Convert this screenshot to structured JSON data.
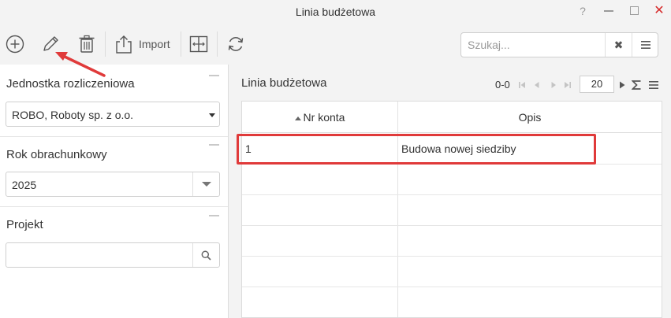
{
  "window": {
    "title": "Linia budżetowa",
    "controls": {
      "help": "?",
      "minimize": "—",
      "maximize": "☐",
      "close": "✕"
    }
  },
  "toolbar": {
    "import_label": "Import",
    "search": {
      "placeholder": "Szukaj...",
      "value": ""
    },
    "icons": [
      "add-icon",
      "edit-icon",
      "delete-icon",
      "import-icon",
      "split-icon",
      "refresh-icon",
      "clear-icon",
      "menu-icon"
    ]
  },
  "filters": {
    "unit": {
      "title": "Jednostka rozliczeniowa",
      "value": "ROBO, Roboty sp. z o.o."
    },
    "year": {
      "title": "Rok obrachunkowy",
      "value": "2025"
    },
    "project": {
      "title": "Projekt",
      "value": ""
    }
  },
  "grid": {
    "title": "Linia budżetowa",
    "pager": {
      "count": "0-0",
      "page_size": "20"
    },
    "columns": [
      {
        "label": "Nr konta",
        "sort": "asc"
      },
      {
        "label": "Opis"
      }
    ],
    "rows": [
      {
        "account": "1",
        "description": "Budowa nowej siedziby"
      }
    ]
  },
  "colors": {
    "annotation": "#e03a3a",
    "background": "#f3f3f3"
  }
}
